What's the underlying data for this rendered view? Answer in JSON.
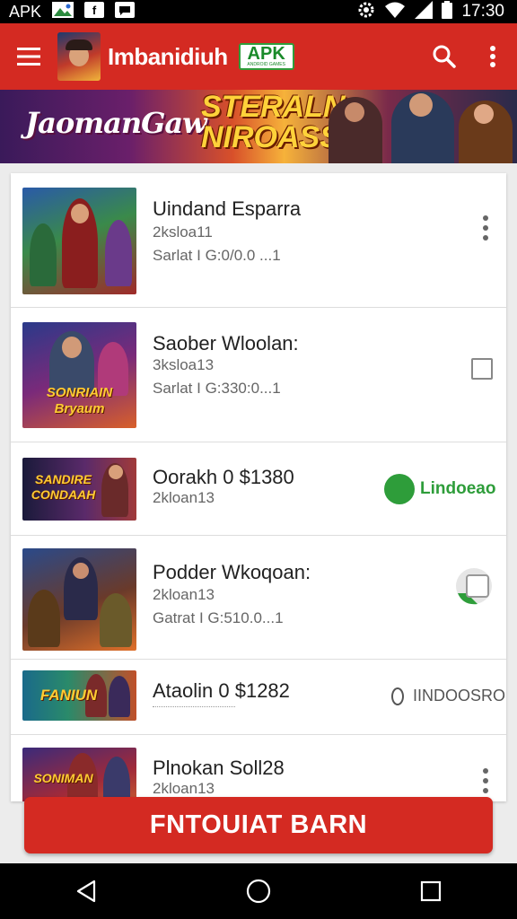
{
  "status_bar": {
    "left_label": "APK",
    "icons": [
      "image-icon",
      "facebook-icon",
      "message-icon"
    ],
    "right_icons": [
      "settings-icon",
      "wifi-icon",
      "signal-icon",
      "battery-icon"
    ],
    "time": "17:30"
  },
  "app_bar": {
    "title": "Imbanidiuh",
    "badge": "APK",
    "badge_sub": "ANDROID GAMES",
    "menu_icon": "hamburger-icon",
    "search_icon": "search-icon",
    "more_icon": "more-vertical-icon",
    "color": "#d42a22"
  },
  "banner": {
    "left_text": "JaomanGaw",
    "center_text": "STERALN NIROASS!"
  },
  "apps": [
    {
      "title": "Uindand Esparra",
      "subtitle": "2ksloa11",
      "meta": "Sarlat I G:0/0.0 ...1",
      "action": "more",
      "thumb_caption": ""
    },
    {
      "title": "Saober Wloolan:",
      "subtitle": "3ksloa13",
      "meta": "Sarlat I G:330:0...1",
      "action": "checkbox",
      "thumb_caption": "SONRIAIN Bryaum"
    },
    {
      "title": "Oorakh 0 $1380",
      "subtitle": "2kloan13",
      "meta": "",
      "action": "install",
      "action_label": "Lindoeao",
      "thumb_caption": "SANDIRE CONDAAH"
    },
    {
      "title": "Podder Wkoqoan:",
      "subtitle": "2kloan13",
      "meta": "Gatrat I G:510.0...1",
      "action": "open",
      "thumb_caption": ""
    },
    {
      "title": "Ataolin 0 $1282",
      "subtitle": "",
      "meta": "",
      "action": "status",
      "action_label": "IINDOOSRO",
      "thumb_caption": "FANIUN"
    },
    {
      "title": "Plnokan Soll28",
      "subtitle": "2kloan13",
      "meta": "",
      "action": "more",
      "thumb_caption": "SONIMAN"
    }
  ],
  "cta": {
    "label": "FNTOUIAT BARN"
  },
  "nav_bar": {
    "back_icon": "back-triangle-icon",
    "home_icon": "home-circle-icon",
    "recents_icon": "recents-square-icon"
  }
}
